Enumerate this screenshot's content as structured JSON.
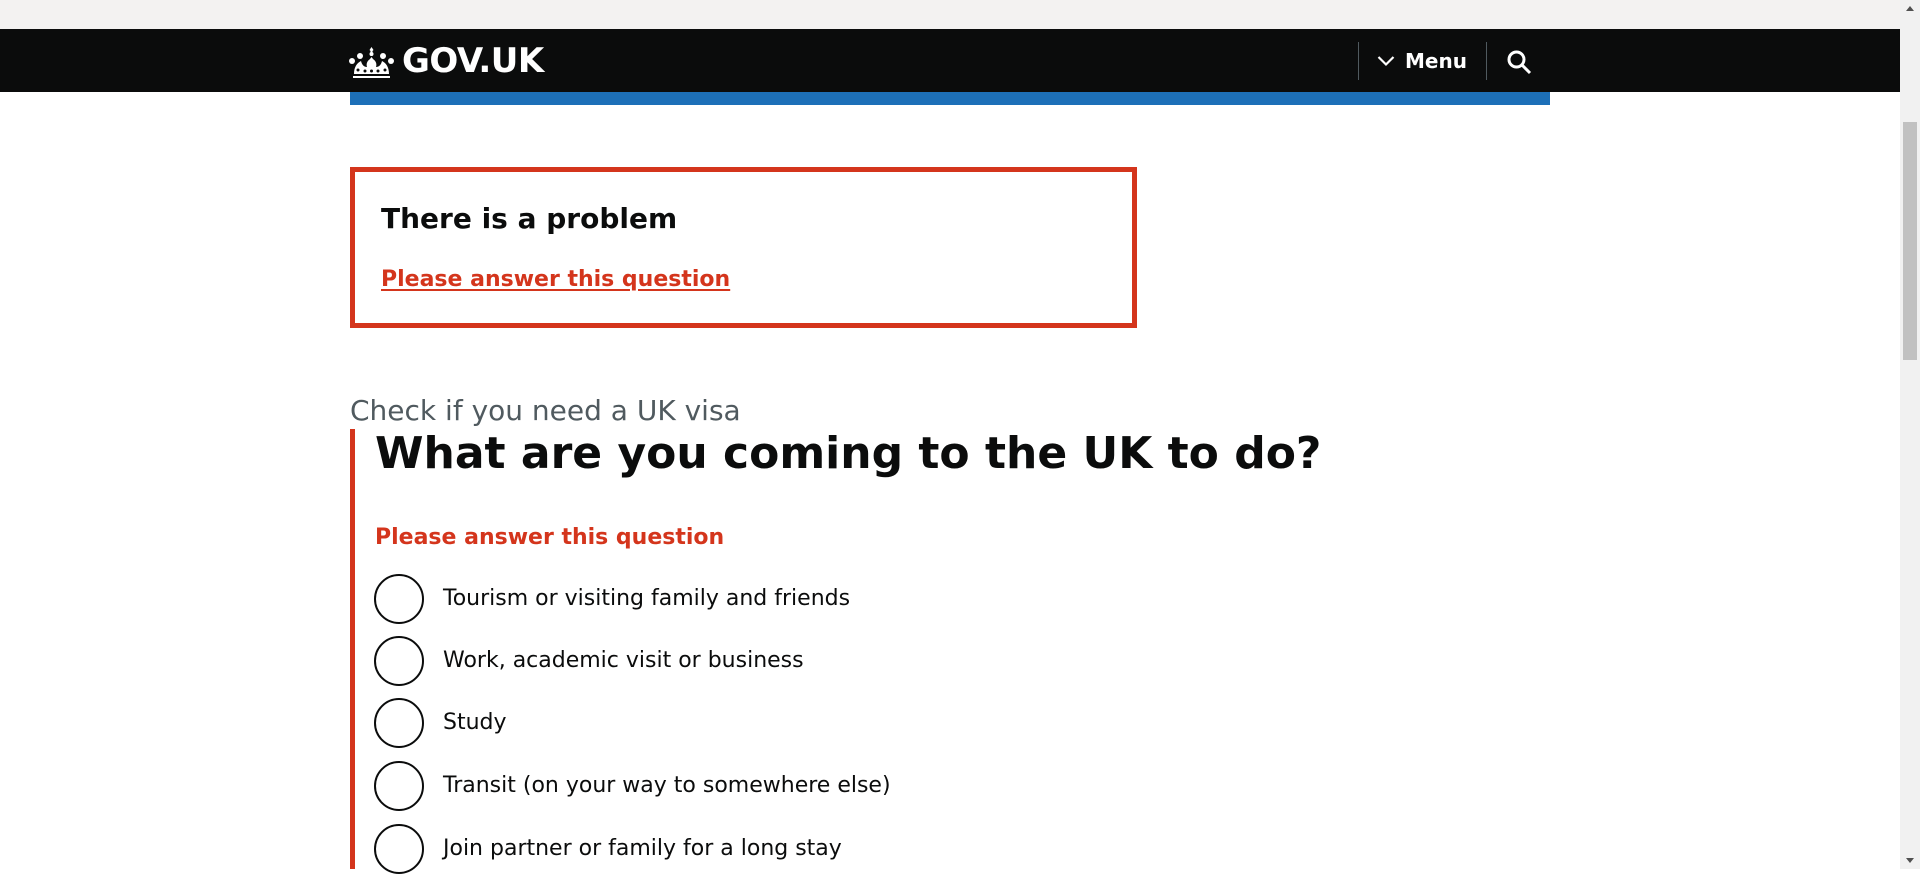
{
  "header": {
    "logo_text": "GOV.UK",
    "menu_label": "Menu",
    "background": "#0b0c0c"
  },
  "error_summary": {
    "title": "There is a problem",
    "link": "Please answer this question",
    "border_color": "#d4351c"
  },
  "form": {
    "caption": "Check if you need a UK visa",
    "question": "What are you coming to the UK to do?",
    "error_message": "Please answer this question",
    "options": [
      "Tourism or visiting family and friends",
      "Work, academic visit or business",
      "Study",
      "Transit (on your way to somewhere else)",
      "Join partner or family for a long stay"
    ]
  },
  "colors": {
    "brand_blue": "#1d70b8",
    "error_red": "#d4351c",
    "text": "#0b0c0c",
    "secondary_text": "#505a5f"
  },
  "icons": {
    "logo": "crown-icon",
    "menu": "chevron-down-icon",
    "search": "search-icon"
  }
}
